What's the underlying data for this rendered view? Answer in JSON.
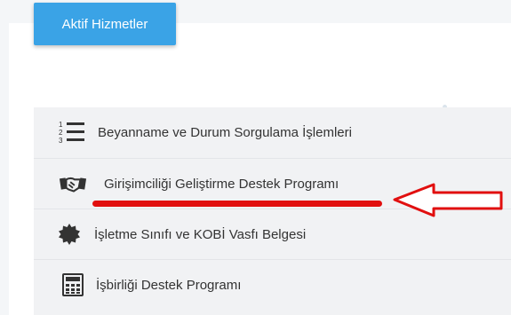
{
  "tabs": {
    "active_services_label": "Aktif Hizmetler"
  },
  "menu": {
    "items": [
      {
        "label": "Beyanname ve Durum Sorgulama İşlemleri",
        "icon": "numbered-list-icon"
      },
      {
        "label": "Girişimciliği Geliştirme Destek Programı",
        "icon": "handshake-icon"
      },
      {
        "label": "İşletme Sınıfı ve KOBİ Vasfı Belgesi",
        "icon": "badge-seal-icon"
      },
      {
        "label": "İşbirliği Destek Programı",
        "icon": "calculator-icon"
      }
    ]
  },
  "annotation": {
    "highlight_color": "#e10f0f",
    "arrow_icon": "left-arrow-annotation"
  },
  "colors": {
    "accent": "#3aa3e6",
    "text": "#333333",
    "list_bg": "#f1f2f4"
  }
}
